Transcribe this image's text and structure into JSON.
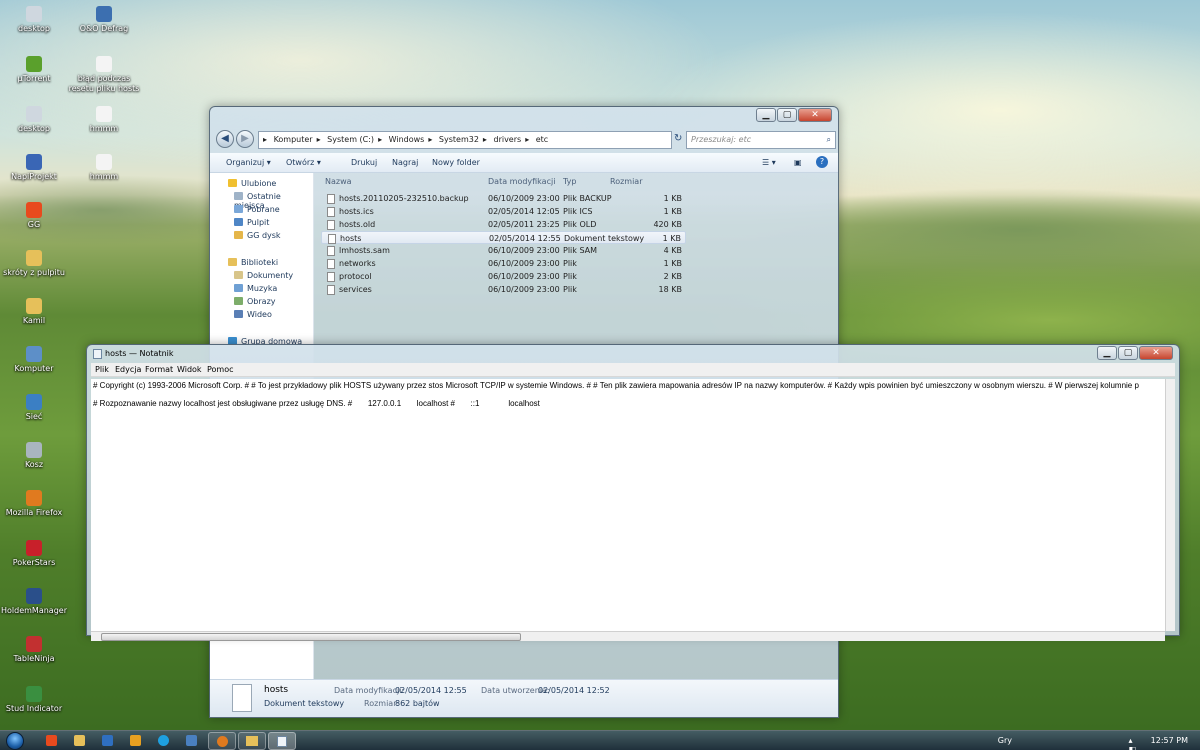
{
  "desktop": {
    "icons": [
      {
        "label": "desktop",
        "color": "#cfd7df"
      },
      {
        "label": "O&O Defrag",
        "color": "#3c6fb0"
      },
      {
        "label": "μTorrent",
        "color": "#5aa02c"
      },
      {
        "label": "błąd podczas resetu pliku hosts",
        "color": "#f4f4f4"
      },
      {
        "label": "desktop",
        "color": "#cfd7df"
      },
      {
        "label": "hmmm",
        "color": "#f4f4f4"
      },
      {
        "label": "NapiProjekt",
        "color": "#3a66b5"
      },
      {
        "label": "hmmm",
        "color": "#f4f4f4"
      },
      {
        "label": "GG",
        "color": "#e84a1e"
      },
      {
        "label": "skróty z pulpitu",
        "color": "#e6c05a"
      },
      {
        "label": "Kamil",
        "color": "#e6c05a"
      },
      {
        "label": "Komputer",
        "color": "#5d8fc8"
      },
      {
        "label": "Sieć",
        "color": "#3b7fc4"
      },
      {
        "label": "Kosz",
        "color": "#a9b5bf"
      },
      {
        "label": "Mozilla Firefox",
        "color": "#e07a1f"
      },
      {
        "label": "PokerStars",
        "color": "#c8202a"
      },
      {
        "label": "HoldemManager",
        "color": "#2a4f8a"
      },
      {
        "label": "TableNinja",
        "color": "#c23030"
      },
      {
        "label": "Stud Indicator",
        "color": "#3a8f40"
      }
    ]
  },
  "explorer": {
    "breadcrumb": [
      "Komputer",
      "System (C:)",
      "Windows",
      "System32",
      "drivers",
      "etc"
    ],
    "search_placeholder": "Przeszukaj: etc",
    "toolbar": {
      "organize": "Organizuj ▾",
      "open": "Otwórz ▾",
      "print": "Drukuj",
      "burn": "Nagraj",
      "new_folder": "Nowy folder"
    },
    "nav": {
      "favorites": "Ulubione",
      "fav_items": [
        "Ostatnie miejsca",
        "Pobrane",
        "Pulpit",
        "GG dysk"
      ],
      "libraries": "Biblioteki",
      "lib_items": [
        "Dokumenty",
        "Muzyka",
        "Obrazy",
        "Wideo"
      ],
      "homegroup": "Grupa domowa"
    },
    "columns": {
      "name": "Nazwa",
      "modified": "Data modyfikacji",
      "type": "Typ",
      "size": "Rozmiar"
    },
    "files": [
      {
        "name": "hosts.20110205-232510.backup",
        "modified": "06/10/2009 23:00",
        "type": "Plik BACKUP",
        "size": "1 KB"
      },
      {
        "name": "hosts.ics",
        "modified": "02/05/2014 12:05",
        "type": "Plik ICS",
        "size": "1 KB"
      },
      {
        "name": "hosts.old",
        "modified": "02/05/2011 23:25",
        "type": "Plik OLD",
        "size": "420 KB"
      },
      {
        "name": "hosts",
        "modified": "02/05/2014 12:55",
        "type": "Dokument tekstowy",
        "size": "1 KB"
      },
      {
        "name": "lmhosts.sam",
        "modified": "06/10/2009 23:00",
        "type": "Plik SAM",
        "size": "4 KB"
      },
      {
        "name": "networks",
        "modified": "06/10/2009 23:00",
        "type": "Plik",
        "size": "1 KB"
      },
      {
        "name": "protocol",
        "modified": "06/10/2009 23:00",
        "type": "Plik",
        "size": "2 KB"
      },
      {
        "name": "services",
        "modified": "06/10/2009 23:00",
        "type": "Plik",
        "size": "18 KB"
      }
    ],
    "details": {
      "name": "hosts",
      "type": "Dokument tekstowy",
      "modified_label": "Data modyfikacji:",
      "modified_value": "02/05/2014 12:55",
      "created_label": "Data utworzenia:",
      "created_value": "02/05/2014 12:52",
      "size_label": "Rozmiar:",
      "size_value": "862 bajtów"
    }
  },
  "notepad": {
    "title": "hosts — Notatnik",
    "menu": [
      "Plik",
      "Edycja",
      "Format",
      "Widok",
      "Pomoc"
    ],
    "line1": "# Copyright (c) 1993-2006 Microsoft Corp. # # To jest przykładowy plik HOSTS używany przez stos Microsoft TCP/IP w systemie Windows. # # Ten plik zawiera mapowania adresów IP na nazwy komputerów. # Każdy wpis powinien być umieszczony w osobnym wierszu. # W pierwszej kolumnie p",
    "line2": "# Rozpoznawanie nazwy localhost jest obsługiwane przez usługę DNS. #       127.0.0.1       localhost #       ::1             localhost"
  },
  "taskbar": {
    "tray_label": "Gry",
    "clock": "12:57 PM"
  }
}
